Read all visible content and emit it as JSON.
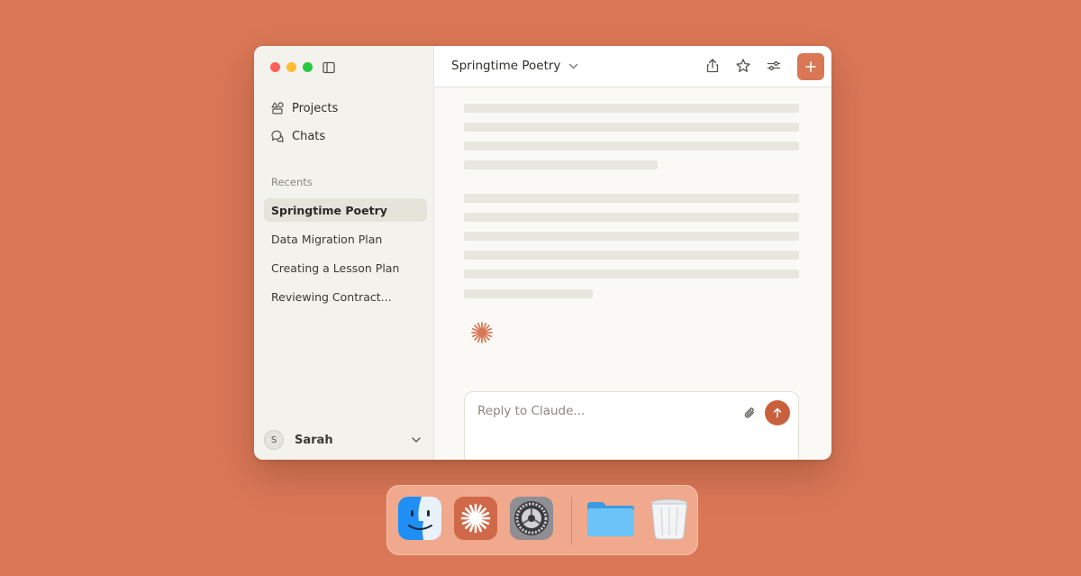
{
  "window": {
    "title": "Springtime Poetry"
  },
  "sidebar": {
    "nav": [
      {
        "label": "Projects",
        "icon": "projects-icon"
      },
      {
        "label": "Chats",
        "icon": "chat-bubbles-icon"
      }
    ],
    "recents_label": "Recents",
    "recents": [
      {
        "label": "Springtime Poetry",
        "active": true
      },
      {
        "label": "Data Migration Plan",
        "active": false
      },
      {
        "label": "Creating a Lesson Plan",
        "active": false
      },
      {
        "label": "Reviewing Contract...",
        "active": false
      }
    ],
    "user": {
      "initial": "S",
      "name": "Sarah"
    }
  },
  "topbar": {
    "title": "Springtime Poetry",
    "actions": [
      "share-icon",
      "star-icon",
      "settings-sliders-icon",
      "new-chat-plus-icon"
    ]
  },
  "composer": {
    "placeholder": "Reply to Claude...",
    "value": ""
  },
  "dock": {
    "apps": [
      "Finder",
      "Claude",
      "System Settings",
      "Folder",
      "Trash"
    ]
  },
  "colors": {
    "background": "#d97756",
    "accent": "#d97756",
    "send": "#c9603d",
    "sidebar": "#f4f2ec",
    "skeleton": "#e8e6df"
  }
}
